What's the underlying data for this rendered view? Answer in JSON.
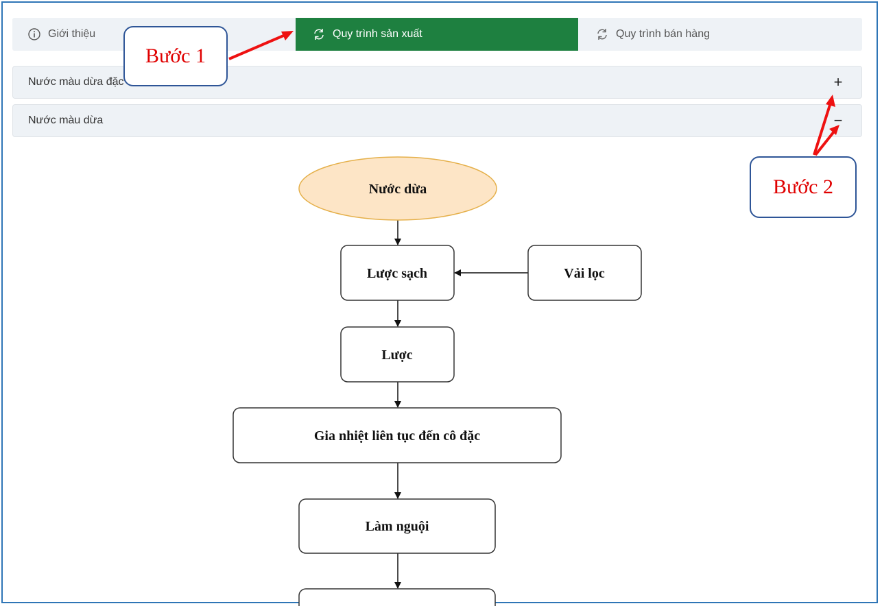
{
  "tabs": {
    "intro": "Giới thiệu",
    "production": "Quy trình sản xuất",
    "sales": "Quy trình bán hàng"
  },
  "accordion": [
    {
      "title": "Nước màu dừa đặc sản",
      "toggle": "+"
    },
    {
      "title": "Nước màu dừa",
      "toggle": "−"
    }
  ],
  "flowchart": {
    "start": "Nước dừa",
    "steps": [
      "Lược sạch",
      "Lược",
      "Gia nhiệt liên tục đến cô đặc",
      "Làm nguội"
    ],
    "side_input": "Vải lọc",
    "start_fill": "#fde5c6",
    "start_stroke": "#e5b04a"
  },
  "annotations": {
    "step1": "Bước 1",
    "step2": "Bước 2",
    "arrow_color": "#ee1111"
  },
  "colors": {
    "active_tab": "#1e8040",
    "frame": "#2e75b6"
  }
}
